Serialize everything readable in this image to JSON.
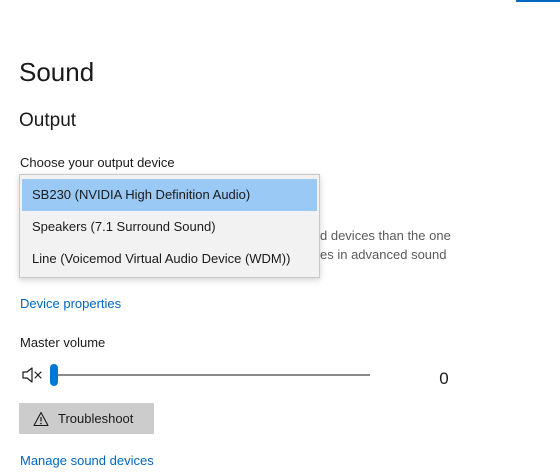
{
  "page": {
    "title": "Sound"
  },
  "output": {
    "section_title": "Output",
    "device_label": "Choose your output device",
    "hint_lines": [
      "d devices than the one",
      "es in advanced sound"
    ],
    "dropdown": {
      "selected_index": 0,
      "options": [
        "SB230 (NVIDIA High Definition Audio)",
        "Speakers (7.1 Surround Sound)",
        "Line (Voicemod Virtual Audio Device (WDM))"
      ]
    },
    "device_properties_link": "Device properties",
    "volume": {
      "label": "Master volume",
      "value_text": "0",
      "level_percent": 0,
      "mute_icon": "speaker-muted-icon"
    },
    "troubleshoot": {
      "label": "Troubleshoot",
      "icon": "warning-icon"
    },
    "manage_devices_link": "Manage sound devices"
  },
  "colors": {
    "accent": "#0078d4",
    "link": "#0067c0",
    "selected_option_bg": "#99c9f4",
    "button_bg": "#cccccc"
  }
}
